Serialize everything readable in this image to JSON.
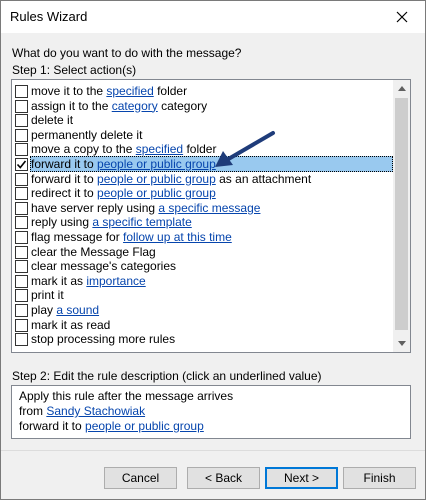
{
  "window": {
    "title": "Rules Wizard"
  },
  "prompt": "What do you want to do with the message?",
  "step1_label": "Step 1: Select action(s)",
  "actions": [
    {
      "checked": false,
      "parts": [
        {
          "t": "move it to the "
        },
        {
          "t": "specified",
          "link": true
        },
        {
          "t": " folder"
        }
      ]
    },
    {
      "checked": false,
      "parts": [
        {
          "t": "assign it to the "
        },
        {
          "t": "category",
          "link": true
        },
        {
          "t": " category"
        }
      ]
    },
    {
      "checked": false,
      "parts": [
        {
          "t": "delete it"
        }
      ]
    },
    {
      "checked": false,
      "parts": [
        {
          "t": "permanently delete it"
        }
      ]
    },
    {
      "checked": false,
      "parts": [
        {
          "t": "move a copy to the "
        },
        {
          "t": "specified",
          "link": true
        },
        {
          "t": " folder"
        }
      ]
    },
    {
      "checked": true,
      "selected": true,
      "parts": [
        {
          "t": "forward it to "
        },
        {
          "t": "people or public group",
          "link": true
        }
      ]
    },
    {
      "checked": false,
      "parts": [
        {
          "t": "forward it to "
        },
        {
          "t": "people or public group",
          "link": true
        },
        {
          "t": " as an attachment"
        }
      ]
    },
    {
      "checked": false,
      "parts": [
        {
          "t": "redirect it to "
        },
        {
          "t": "people or public group",
          "link": true
        }
      ]
    },
    {
      "checked": false,
      "parts": [
        {
          "t": "have server reply using "
        },
        {
          "t": "a specific message",
          "link": true
        }
      ]
    },
    {
      "checked": false,
      "parts": [
        {
          "t": "reply using "
        },
        {
          "t": "a specific template",
          "link": true
        }
      ]
    },
    {
      "checked": false,
      "parts": [
        {
          "t": "flag message for "
        },
        {
          "t": "follow up at this time",
          "link": true
        }
      ]
    },
    {
      "checked": false,
      "parts": [
        {
          "t": "clear the Message Flag"
        }
      ]
    },
    {
      "checked": false,
      "parts": [
        {
          "t": "clear message's categories"
        }
      ]
    },
    {
      "checked": false,
      "parts": [
        {
          "t": "mark it as "
        },
        {
          "t": "importance",
          "link": true
        }
      ]
    },
    {
      "checked": false,
      "parts": [
        {
          "t": "print it"
        }
      ]
    },
    {
      "checked": false,
      "parts": [
        {
          "t": "play "
        },
        {
          "t": "a sound",
          "link": true
        }
      ]
    },
    {
      "checked": false,
      "parts": [
        {
          "t": "mark it as read"
        }
      ]
    },
    {
      "checked": false,
      "parts": [
        {
          "t": "stop processing more rules"
        }
      ]
    }
  ],
  "step2_label": "Step 2: Edit the rule description (click an underlined value)",
  "description": {
    "line1": "Apply this rule after the message arrives",
    "line2_prefix": "from ",
    "line2_link": "Sandy Stachowiak",
    "line3_prefix": "forward it to ",
    "line3_link": "people or public group"
  },
  "buttons": {
    "cancel": "Cancel",
    "back": "< Back",
    "next": "Next >",
    "finish": "Finish"
  },
  "colors": {
    "link": "#0645ad",
    "selection": "#99c9ef",
    "arrow": "#1f3c7a",
    "default_button_border": "#0078d7"
  }
}
